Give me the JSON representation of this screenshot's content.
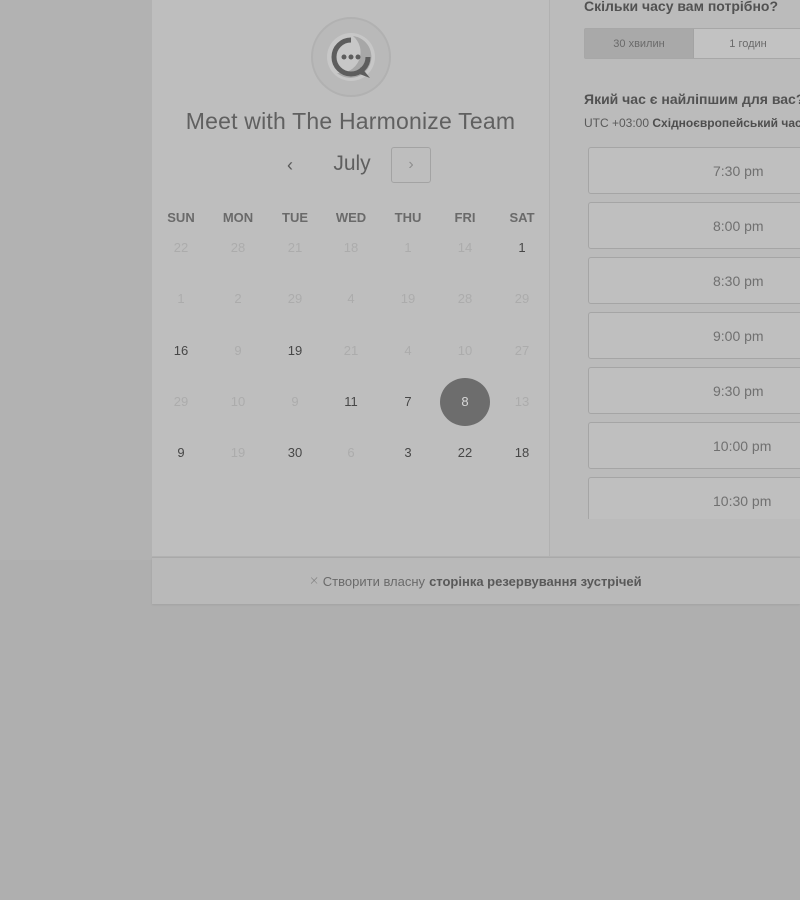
{
  "widget": {
    "team_title": "Meet with The Harmonize Team",
    "month": "July",
    "prev_icon": "‹",
    "next_icon": "›",
    "weekdays": [
      "SUN",
      "MON",
      "TUE",
      "WED",
      "THU",
      "FRI",
      "SAT"
    ],
    "weeks": [
      [
        {
          "d": "22",
          "a": false
        },
        {
          "d": "28",
          "a": false
        },
        {
          "d": "21",
          "a": false
        },
        {
          "d": "18",
          "a": false
        },
        {
          "d": "1",
          "a": false
        },
        {
          "d": "14",
          "a": false
        },
        {
          "d": "1",
          "a": true
        }
      ],
      [
        {
          "d": "1",
          "a": false
        },
        {
          "d": "2",
          "a": false
        },
        {
          "d": "29",
          "a": false
        },
        {
          "d": "4",
          "a": false
        },
        {
          "d": "19",
          "a": false
        },
        {
          "d": "28",
          "a": false
        },
        {
          "d": "29",
          "a": false
        }
      ],
      [
        {
          "d": "16",
          "a": true
        },
        {
          "d": "9",
          "a": false
        },
        {
          "d": "19",
          "a": true
        },
        {
          "d": "21",
          "a": false
        },
        {
          "d": "4",
          "a": false
        },
        {
          "d": "10",
          "a": false
        },
        {
          "d": "27",
          "a": false
        }
      ],
      [
        {
          "d": "29",
          "a": false
        },
        {
          "d": "10",
          "a": false
        },
        {
          "d": "9",
          "a": false
        },
        {
          "d": "11",
          "a": true
        },
        {
          "d": "7",
          "a": true
        },
        {
          "d": "8",
          "a": true,
          "selected": true
        },
        {
          "d": "13",
          "a": false
        }
      ],
      [
        {
          "d": "9",
          "a": true
        },
        {
          "d": "19",
          "a": false
        },
        {
          "d": "30",
          "a": true
        },
        {
          "d": "6",
          "a": false
        },
        {
          "d": "3",
          "a": true
        },
        {
          "d": "22",
          "a": true
        },
        {
          "d": "18",
          "a": true
        }
      ]
    ]
  },
  "right": {
    "duration_question": "Скільки часу вам потрібно?",
    "durations": [
      "30 хвилин",
      "1 годин"
    ],
    "time_question": "Який час є найліпшим для вас?",
    "timezone_offset": "UTC +03:00",
    "timezone_name": "Східноєвропейський час",
    "slots": [
      "7:30 pm",
      "8:00 pm",
      "8:30 pm",
      "9:00 pm",
      "9:30 pm",
      "10:00 pm",
      "10:30 pm"
    ]
  },
  "footer": {
    "icon": "hubspot-sprocket-icon",
    "prefix": "Створити власну",
    "bold": "сторінка резервування зустрічей"
  }
}
